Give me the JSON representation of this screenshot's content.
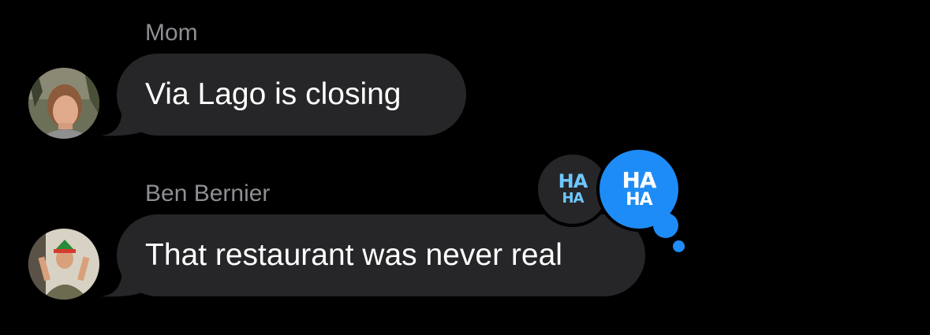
{
  "colors": {
    "background": "#000000",
    "bubble": "#262629",
    "sender_name": "#8e8e93",
    "message_text": "#ffffff",
    "reaction_accent": "#1e8cf6",
    "reaction_other_bg": "#262629"
  },
  "messages": [
    {
      "sender": "Mom",
      "text": "Via Lago is closing",
      "avatar": "photo-avatar-mom"
    },
    {
      "sender": "Ben Bernier",
      "text": "That restaurant was never real",
      "avatar": "photo-avatar-ben-bernier",
      "reactions": [
        {
          "icon": "haha-tapback-icon",
          "line1": "HA",
          "line2": "HA",
          "mine": false
        },
        {
          "icon": "haha-tapback-icon",
          "line1": "HA",
          "line2": "HA",
          "mine": true
        }
      ]
    }
  ]
}
